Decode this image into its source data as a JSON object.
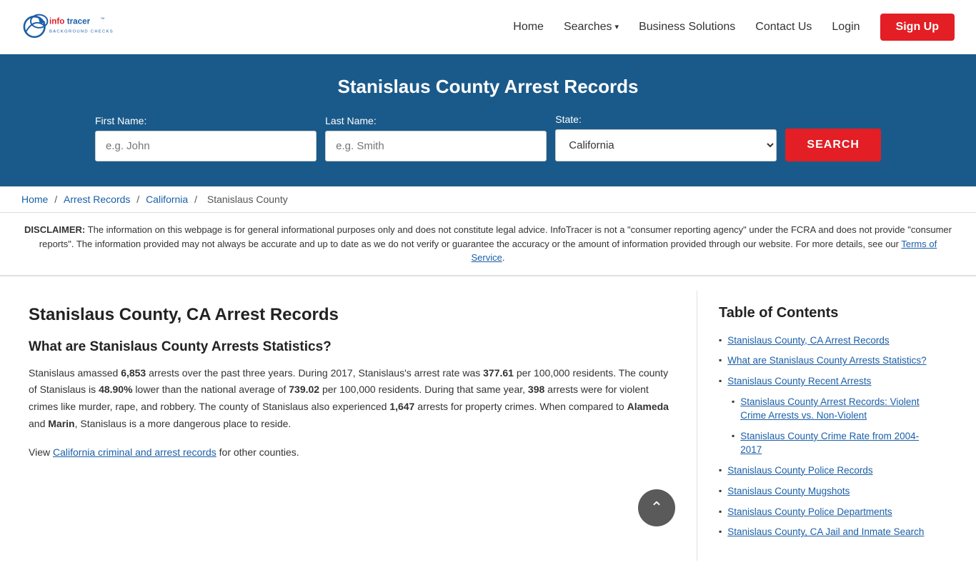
{
  "header": {
    "logo_alt": "InfoTracer",
    "nav": {
      "home": "Home",
      "searches": "Searches",
      "business_solutions": "Business Solutions",
      "contact_us": "Contact Us",
      "login": "Login",
      "signup": "Sign Up"
    }
  },
  "hero": {
    "title": "Stanislaus County Arrest Records",
    "form": {
      "first_name_label": "First Name:",
      "first_name_placeholder": "e.g. John",
      "last_name_label": "Last Name:",
      "last_name_placeholder": "e.g. Smith",
      "state_label": "State:",
      "state_value": "California",
      "search_button": "SEARCH"
    }
  },
  "breadcrumb": {
    "home": "Home",
    "arrest_records": "Arrest Records",
    "california": "California",
    "stanislaus_county": "Stanislaus County"
  },
  "disclaimer": {
    "label": "DISCLAIMER:",
    "text": "The information on this webpage is for general informational purposes only and does not constitute legal advice. InfoTracer is not a \"consumer reporting agency\" under the FCRA and does not provide \"consumer reports\". The information provided may not always be accurate and up to date as we do not verify or guarantee the accuracy or the amount of information provided through our website. For more details, see our",
    "tos_link": "Terms of Service",
    "period": "."
  },
  "article": {
    "h2": "Stanislaus County, CA Arrest Records",
    "h3": "What are Stanislaus County Arrests Statistics?",
    "p1_before_1": "Stanislaus amassed ",
    "p1_bold1": "6,853",
    "p1_mid1": " arrests over the past three years. During 2017, Stanislaus's arrest rate was ",
    "p1_bold2": "377.61",
    "p1_mid2": " per 100,000 residents. The county of Stanislaus is ",
    "p1_bold3": "48.90%",
    "p1_mid3": " lower than the national average of ",
    "p1_bold4": "739.02",
    "p1_mid4": " per 100,000 residents. During that same year, ",
    "p1_bold5": "398",
    "p1_mid5": " arrests were for violent crimes like murder, rape, and robbery. The county of Stanislaus also experienced ",
    "p1_bold6": "1,647",
    "p1_mid6": " arrests for property crimes. When compared to ",
    "p1_bold7": "Alameda",
    "p1_mid7": " and ",
    "p1_bold8": "Marin",
    "p1_end": ", Stanislaus is a more dangerous place to reside.",
    "p2_before": "View ",
    "p2_link": "California criminal and arrest records",
    "p2_after": " for other counties."
  },
  "toc": {
    "title": "Table of Contents",
    "items": [
      {
        "label": "Stanislaus County, CA Arrest Records",
        "sub": false
      },
      {
        "label": "What are Stanislaus County Arrests Statistics?",
        "sub": false
      },
      {
        "label": "Stanislaus County Recent Arrests",
        "sub": false
      },
      {
        "label": "Stanislaus County Arrest Records: Violent Crime Arrests vs. Non-Violent",
        "sub": true
      },
      {
        "label": "Stanislaus County Crime Rate from 2004-2017",
        "sub": true
      },
      {
        "label": "Stanislaus County Police Records",
        "sub": false
      },
      {
        "label": "Stanislaus County Mugshots",
        "sub": false
      },
      {
        "label": "Stanislaus County Police Departments",
        "sub": false
      },
      {
        "label": "Stanislaus County, CA Jail and Inmate Search",
        "sub": false
      }
    ]
  }
}
